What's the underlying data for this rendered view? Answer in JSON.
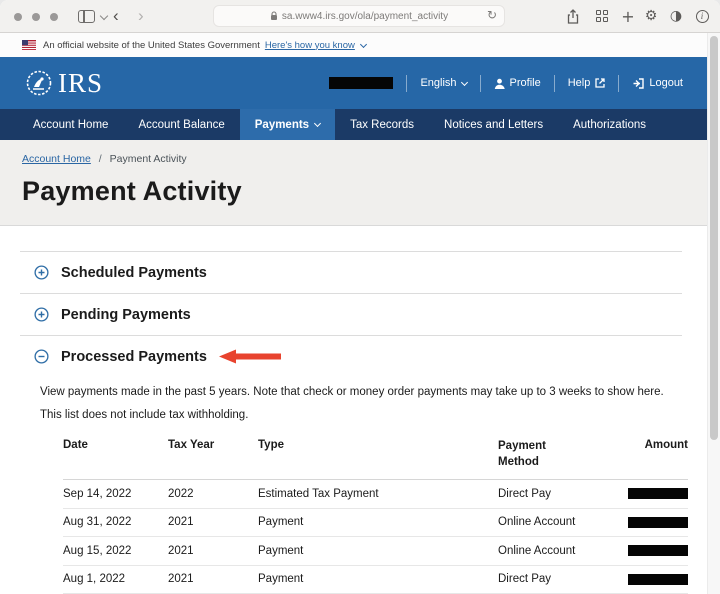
{
  "browser": {
    "url": "sa.www4.irs.gov/ola/payment_activity"
  },
  "icons": {
    "back": "‹",
    "forward": "›",
    "refresh": "↻",
    "plus": "+",
    "gear": "⚙",
    "half_moon": "◑",
    "info": "i"
  },
  "banner": {
    "text": "An official website of the United States Government",
    "link": "Here's how you know"
  },
  "header": {
    "logo_text": "IRS",
    "language_label": "English",
    "profile_label": "Profile",
    "help_label": "Help",
    "logout_label": "Logout"
  },
  "nav": {
    "items": [
      {
        "label": "Account Home"
      },
      {
        "label": "Account Balance"
      },
      {
        "label": "Payments",
        "active": true,
        "has_chevron": true
      },
      {
        "label": "Tax Records"
      },
      {
        "label": "Notices and Letters"
      },
      {
        "label": "Authorizations"
      }
    ]
  },
  "breadcrumb": {
    "link": "Account Home",
    "separator": "/",
    "current": "Payment Activity"
  },
  "page": {
    "title": "Payment Activity"
  },
  "sections": [
    {
      "label": "Scheduled Payments",
      "expanded": false
    },
    {
      "label": "Pending Payments",
      "expanded": false
    },
    {
      "label": "Processed Payments",
      "expanded": true,
      "annotated": true
    }
  ],
  "processed": {
    "intro": "View payments made in the past 5 years. Note that check or money order payments may take up to 3 weeks to show here.",
    "note": "This list does not include tax withholding.",
    "table": {
      "headers": {
        "date": "Date",
        "tax_year": "Tax Year",
        "type": "Type",
        "method": "Payment Method",
        "amount": "Amount"
      },
      "rows": [
        {
          "date": "Sep 14, 2022",
          "tax_year": "2022",
          "type": "Estimated Tax Payment",
          "method": "Direct Pay",
          "amount_redacted": true
        },
        {
          "date": "Aug 31, 2022",
          "tax_year": "2021",
          "type": "Payment",
          "method": "Online Account",
          "amount_redacted": true
        },
        {
          "date": "Aug 15, 2022",
          "tax_year": "2021",
          "type": "Payment",
          "method": "Online Account",
          "amount_redacted": true
        },
        {
          "date": "Aug 1, 2022",
          "tax_year": "2021",
          "type": "Payment",
          "method": "Direct Pay",
          "amount_redacted": true
        }
      ]
    }
  },
  "colors": {
    "header_blue": "#2667a7",
    "nav_navy": "#1b3a66",
    "active_tab_blue": "#2d6cab",
    "link_blue": "#2a66a4",
    "annotation_red": "#e8432e"
  }
}
